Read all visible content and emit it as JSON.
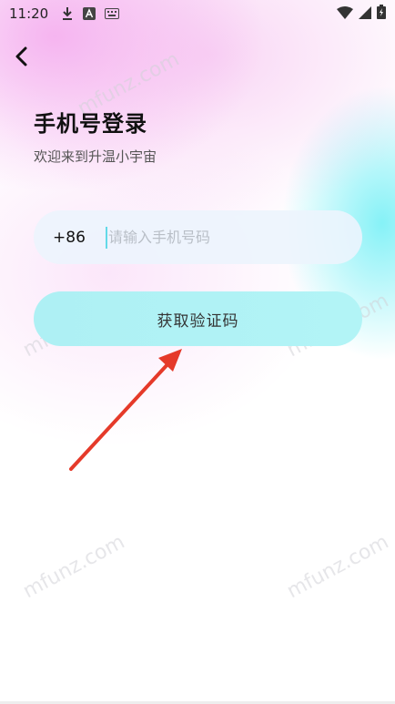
{
  "status_bar": {
    "time": "11:20",
    "icons_left": [
      "download-icon",
      "a-icon",
      "keyboard-icon"
    ],
    "icons_right": [
      "wifi-icon",
      "signal-icon",
      "battery-icon"
    ]
  },
  "header": {
    "title": "手机号登录",
    "subtitle": "欢迎来到升温小宇宙"
  },
  "form": {
    "country_code": "+86",
    "phone_placeholder": "请输入手机号码",
    "phone_value": "",
    "get_code_label": "获取验证码"
  },
  "watermark_text": "mfunz.com",
  "colors": {
    "button_bg": "#aef0f4",
    "field_bg": "#ecf4fd",
    "arrow": "#e53a2a",
    "cursor": "#63d9e8"
  }
}
